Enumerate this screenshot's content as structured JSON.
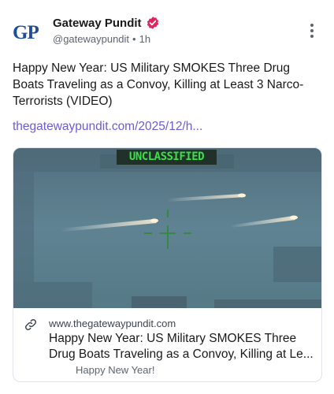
{
  "author": {
    "avatar_text": "GP",
    "display_name": "Gateway Pundit",
    "handle": "@gatewaypundit",
    "time": "1h"
  },
  "post": {
    "text": "Happy New Year: US Military SMOKES Three Drug Boats Traveling as a Convoy, Killing at Least 3 Narco-Terrorists (VIDEO)",
    "link": "thegatewaypundit.com/2025/12/h..."
  },
  "card": {
    "image_label": "UNCLASSIFIED",
    "domain": "www.thegatewaypundit.com",
    "title": "Happy New Year: US Military SMOKES Three Drug Boats Traveling as a Convoy, Killing at Le...",
    "description": "Happy New Year!"
  },
  "icons": {
    "verified": "verified-badge-icon",
    "more": "more-vertical-icon",
    "link": "link-icon"
  },
  "colors": {
    "link": "#6f5bd6",
    "verified": "#e0245e",
    "label_green": "#39e04a",
    "sea": "#5b7d8c"
  }
}
